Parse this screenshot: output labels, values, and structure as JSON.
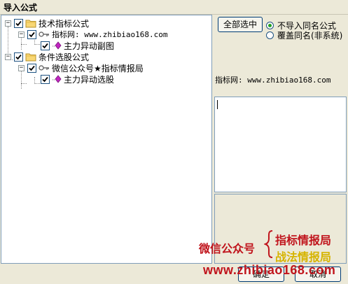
{
  "window": {
    "title": "导入公式"
  },
  "tree": {
    "nodes": [
      {
        "label": "技术指标公式",
        "expander": "−",
        "icon": "folder-icon"
      },
      {
        "label": "指标网: www.zhibiao168.com",
        "expander": "−",
        "icon": "key-icon"
      },
      {
        "label": "主力异动副图",
        "icon": "gem-icon"
      },
      {
        "label": "条件选股公式",
        "expander": "−",
        "icon": "folder-icon"
      },
      {
        "label": "微信公众号★指标情报局",
        "expander": "−",
        "icon": "key-icon"
      },
      {
        "label": "主力异动选股",
        "icon": "gem-icon"
      }
    ]
  },
  "options": {
    "select_all_label": "全部选中",
    "radio_skip_label": "不导入同名公式",
    "radio_overwrite_label": "覆盖同名(非系统)",
    "selected": "skip"
  },
  "info": {
    "source_text": "指标网: www.zhibiao168.com"
  },
  "buttons": {
    "ok_label": "确定",
    "cancel_label": "取消"
  },
  "watermark": {
    "left_text": "微信公众号",
    "right_line1": "指标情报局",
    "right_line2": "战法情报局",
    "url": "www.zhibiao168.com"
  },
  "colors": {
    "check": "#21a121",
    "watermark_red": "#c0141c",
    "watermark_gold": "#d6b400"
  }
}
